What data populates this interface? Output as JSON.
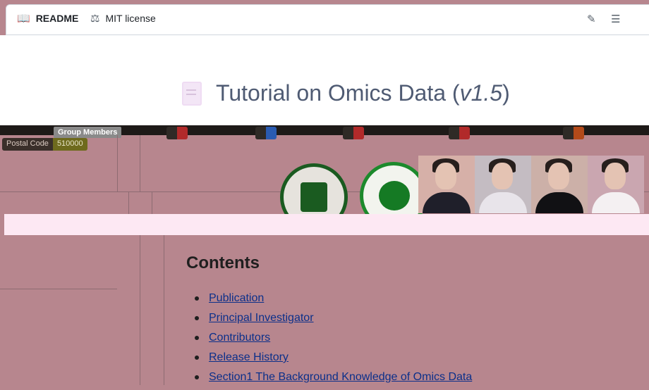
{
  "tabs": {
    "readme": "README",
    "license": "MIT license"
  },
  "toolbar": {
    "edit_icon": "pencil-icon",
    "outline_icon": "list-icon"
  },
  "readme": {
    "title_prefix": "Tutorial on Omics Data (",
    "title_version": "v1.5",
    "title_suffix": ")"
  },
  "badges": [
    {
      "k": "Group Members",
      "v": ""
    },
    {
      "k": "Postal Code",
      "v": "510000"
    }
  ],
  "contents": {
    "heading": "Contents",
    "items": [
      "Publication",
      "Principal Investigator",
      "Contributors",
      "Release History",
      "Section1 The Background Knowledge of Omics Data"
    ]
  },
  "colors": {
    "background": "#b7868e",
    "link": "#0b2f8a",
    "title": "#4f5b73"
  }
}
